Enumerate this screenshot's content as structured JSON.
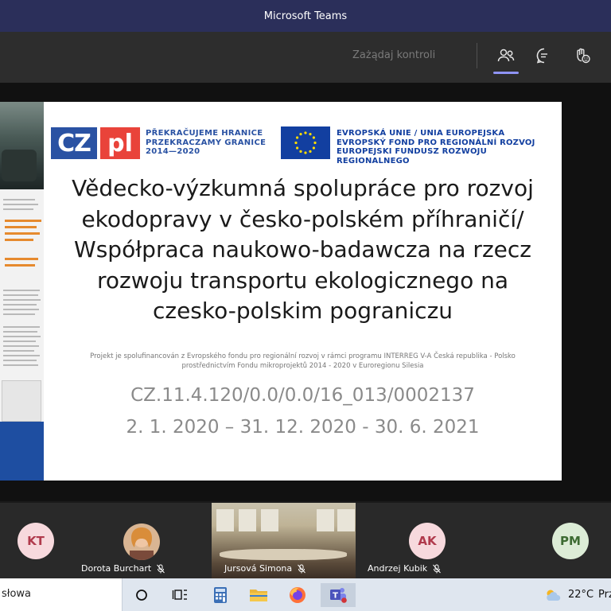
{
  "window": {
    "title": "Microsoft Teams"
  },
  "toolbar": {
    "request_control": "Zażądaj kontroli"
  },
  "slide": {
    "logo_cz": "CZ",
    "logo_pl": "pl",
    "brand_lines": [
      "PŘEKRAČUJEME HRANICE",
      "PRZEKRACZAMY GRANICE",
      "2014—2020"
    ],
    "eu_lines": [
      "EVROPSKÁ UNIE / UNIA EUROPEJSKA",
      "EVROPSKÝ FOND PRO REGIONÁLNÍ ROZVOJ",
      "EUROPEJSKI FUNDUSZ ROZWOJU REGIONALNEGO"
    ],
    "title_lines": [
      "Vědecko-výzkumná spolupráce pro rozvoj",
      "ekodopravy v česko-polském příhraničí/",
      "Współpraca naukowo-badawcza na rzecz",
      "rozwoju transportu ekologicznego na",
      "czesko-polskim pograniczu"
    ],
    "note_lines": [
      "Projekt je spolufinancován z Evropského fondu pro regionální rozvoj v rámci programu INTERREG V-A Česká republika - Polsko",
      "prostřednictvím Fondu mikroprojektů 2014 - 2020 v Euroregionu Silesia"
    ],
    "code": "CZ.11.4.120/0.0/0.0/16_013/0002137",
    "dates": "2. 1. 2020 – 31. 12. 2020 -  30. 6. 2021"
  },
  "participants": [
    {
      "initials": "KT",
      "name": ""
    },
    {
      "initials": "",
      "name": "Dorota Burchart"
    },
    {
      "initials": "",
      "name": "Jursová Simona"
    },
    {
      "initials": "AK",
      "name": "Andrzej Kubik"
    },
    {
      "initials": "PM",
      "name": ""
    }
  ],
  "taskbar": {
    "search_text": "słowa",
    "temperature": "22°C",
    "extra": "Prz"
  },
  "colors": {
    "titlebar": "#2b2f5a",
    "accent": "#8f94f5",
    "cz_blue": "#2a52a3",
    "pl_red": "#e9433a",
    "eu_blue": "#123fa0"
  }
}
